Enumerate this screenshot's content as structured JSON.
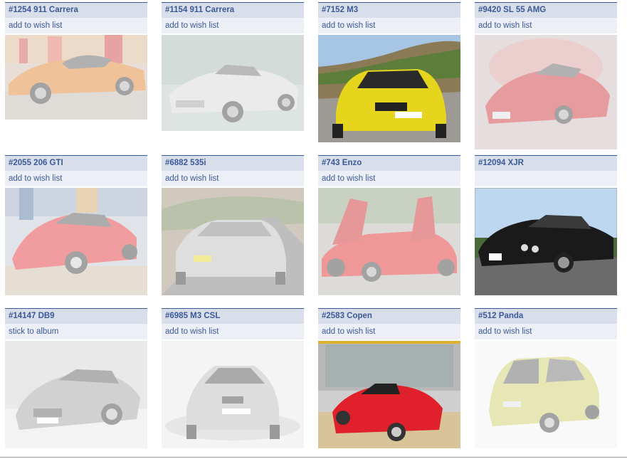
{
  "cards": [
    {
      "title": "#1254 911 Carrera",
      "action": "add to wish list",
      "car_color": "#e07a1f",
      "photo": "orange-porsche-911-photo"
    },
    {
      "title": "#1154 911 Carrera",
      "action": "add to wish list",
      "car_color": "#b9b9b9",
      "photo": "silver-porsche-911-cabriolet-photo"
    },
    {
      "title": "#7152 M3",
      "action": "add to wish list",
      "car_color": "#e5d51c",
      "photo": "yellow-bmw-m3-photo"
    },
    {
      "title": "#9420 SL 55 AMG",
      "action": "add to wish list",
      "car_color": "#c8232c",
      "photo": "red-mercedes-sl55-photo"
    },
    {
      "title": "#2055 206 GTI",
      "action": "add to wish list",
      "car_color": "#e2282e",
      "photo": "red-peugeot-206-gti-photo"
    },
    {
      "title": "#6882 535i",
      "action": "add to wish list",
      "car_color": "#b8b8b8",
      "photo": "silver-bmw-535i-photo"
    },
    {
      "title": "#743 Enzo",
      "action": "add to wish list",
      "car_color": "#e01c1c",
      "photo": "red-ferrari-enzo-photo"
    },
    {
      "title": "#12094 XJR",
      "action": "",
      "car_color": "#1a1a1a",
      "photo": "black-jaguar-xjr-photo"
    },
    {
      "title": "#14147 DB9",
      "action": "stick to album",
      "car_color": "#9a9a9a",
      "photo": "silver-aston-martin-db9-photo"
    },
    {
      "title": "#6985 M3 CSL",
      "action": "add to wish list",
      "car_color": "#b4b4b4",
      "photo": "silver-bmw-m3-csl-photo"
    },
    {
      "title": "#2583 Copen",
      "action": "add to wish list",
      "car_color": "#e0202a",
      "photo": "red-daihatsu-copen-photo"
    },
    {
      "title": "#512 Panda",
      "action": "add to wish list",
      "car_color": "#c9cc5a",
      "photo": "green-fiat-panda-photo"
    }
  ]
}
